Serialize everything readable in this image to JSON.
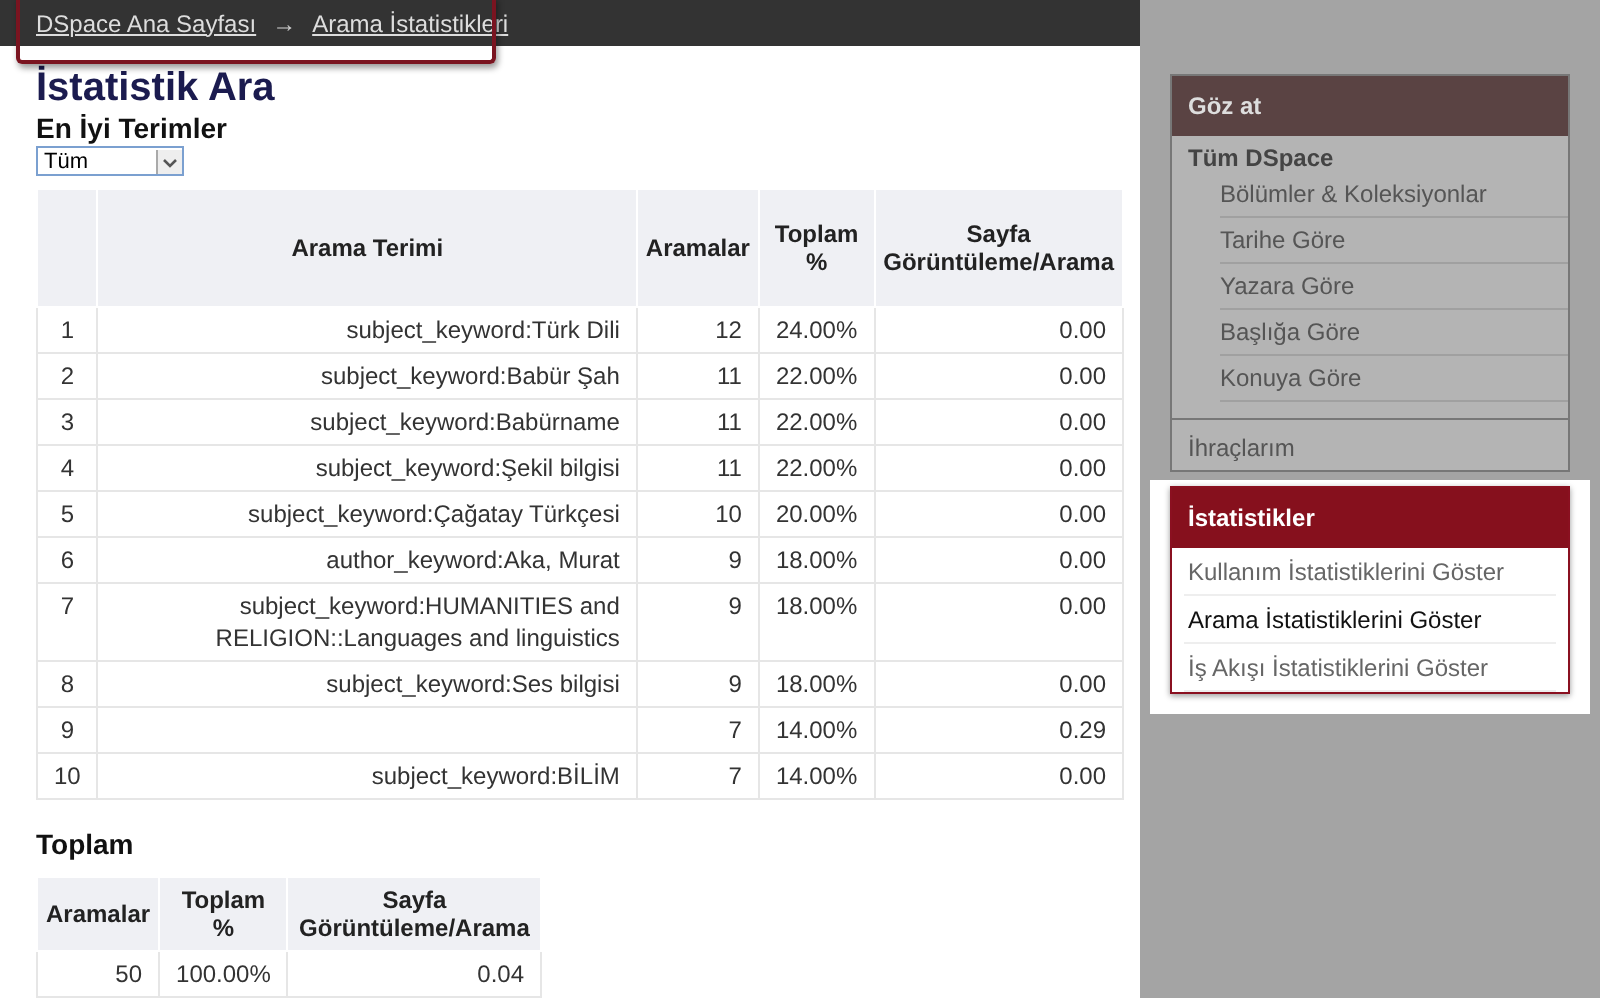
{
  "breadcrumb": {
    "items": [
      {
        "label": "DSpace Ana Sayfası"
      },
      {
        "label": "Arama İstatistikleri"
      }
    ],
    "separator": "→"
  },
  "title": "İstatistik Ara",
  "subtitle": "En İyi Terimler",
  "filter": {
    "value": "Tüm"
  },
  "table": {
    "columns": [
      "",
      "Arama Terimi",
      "Aramalar",
      "Toplam %",
      "Sayfa Görüntüleme/Arama"
    ],
    "rows": [
      {
        "cells": [
          "1",
          "subject_keyword:Türk Dili",
          "12",
          "24.00%",
          "0.00"
        ]
      },
      {
        "cells": [
          "2",
          "subject_keyword:Babür Şah",
          "11",
          "22.00%",
          "0.00"
        ]
      },
      {
        "cells": [
          "3",
          "subject_keyword:Babürname",
          "11",
          "22.00%",
          "0.00"
        ]
      },
      {
        "cells": [
          "4",
          "subject_keyword:Şekil bilgisi",
          "11",
          "22.00%",
          "0.00"
        ]
      },
      {
        "cells": [
          "5",
          "subject_keyword:Çağatay Türkçesi",
          "10",
          "20.00%",
          "0.00"
        ]
      },
      {
        "cells": [
          "6",
          "author_keyword:Aka, Murat",
          "9",
          "18.00%",
          "0.00"
        ]
      },
      {
        "cells": [
          "7",
          "subject_keyword:HUMANITIES and RELIGION::Languages and linguistics",
          "9",
          "18.00%",
          "0.00"
        ]
      },
      {
        "cells": [
          "8",
          "subject_keyword:Ses bilgisi",
          "9",
          "18.00%",
          "0.00"
        ]
      },
      {
        "cells": [
          "9",
          "",
          "7",
          "14.00%",
          "0.29"
        ]
      },
      {
        "cells": [
          "10",
          "subject_keyword:BİLİM",
          "7",
          "14.00%",
          "0.00"
        ]
      }
    ]
  },
  "totals": {
    "heading": "Toplam",
    "columns": [
      "Aramalar",
      "Toplam %",
      "Sayfa Görüntüleme/Arama"
    ],
    "cells": [
      "50",
      "100.00%",
      "0.04"
    ]
  },
  "sidebar": {
    "browse": {
      "title": "Göz at",
      "group": "Tüm DSpace",
      "items": [
        {
          "label": "Bölümler & Koleksiyonlar"
        },
        {
          "label": "Tarihe Göre"
        },
        {
          "label": "Yazara Göre"
        },
        {
          "label": "Başlığa Göre"
        },
        {
          "label": "Konuya Göre"
        }
      ],
      "export": "İhraçlarım"
    },
    "statistics": {
      "title": "İstatistikler",
      "items": [
        {
          "label": "Kullanım İstatistiklerini Göster",
          "selected": false
        },
        {
          "label": "Arama İstatistiklerini Göster",
          "selected": true
        },
        {
          "label": "İş Akışı İstatistiklerini Göster",
          "selected": false
        }
      ]
    }
  }
}
